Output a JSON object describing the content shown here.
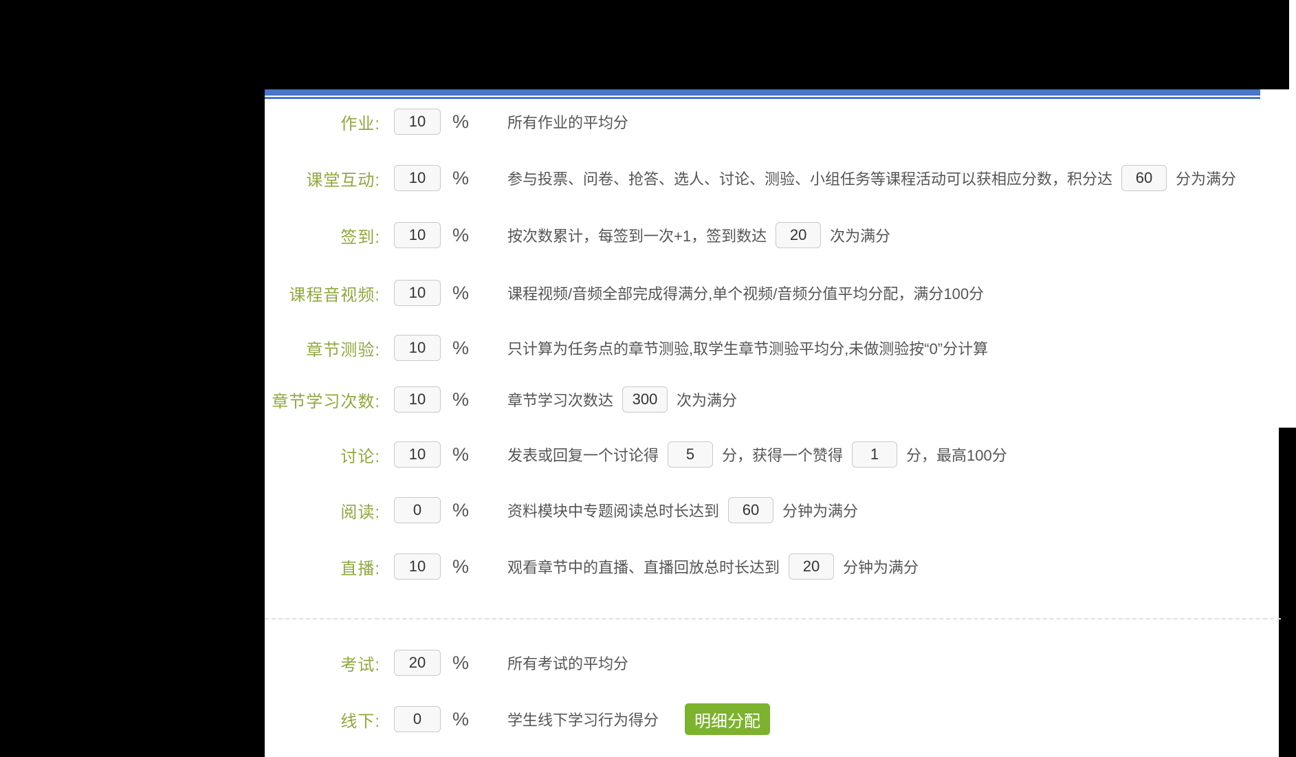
{
  "colors": {
    "accent_blue": "#4a76c8",
    "label_green": "#8fa83e",
    "button_green": "#7cb22e",
    "desc_gray": "#555555"
  },
  "weights_form": {
    "percent_sign": "%",
    "rows": [
      {
        "id": "homework",
        "label": "作业:",
        "percent": "10",
        "desc": [
          {
            "t": "所有作业的平均分"
          }
        ]
      },
      {
        "id": "class-interaction",
        "label": "课堂互动:",
        "percent": "10",
        "desc": [
          {
            "t": "参与投票、问卷、抢答、选人、讨论、测验、小组任务等课程活动可以获相应分数，积分达"
          },
          {
            "v": "60"
          },
          {
            "t": "分为满分"
          }
        ]
      },
      {
        "id": "sign-in",
        "label": "签到:",
        "percent": "10",
        "desc": [
          {
            "t": "按次数累计，每签到一次+1，签到数达"
          },
          {
            "v": "20"
          },
          {
            "t": "次为满分"
          }
        ]
      },
      {
        "id": "course-av",
        "label": "课程音视频:",
        "percent": "10",
        "desc": [
          {
            "t": "课程视频/音频全部完成得满分,单个视频/音频分值平均分配，满分100分"
          }
        ]
      },
      {
        "id": "chapter-quiz",
        "label": "章节测验:",
        "percent": "10",
        "desc": [
          {
            "t": "只计算为任务点的章节测验,取学生章节测验平均分,未做测验按“0”分计算"
          }
        ]
      },
      {
        "id": "chapter-visits",
        "label": "章节学习次数:",
        "percent": "10",
        "desc": [
          {
            "t": "章节学习次数达"
          },
          {
            "v": "300"
          },
          {
            "t": "次为满分"
          }
        ]
      },
      {
        "id": "discussion",
        "label": "讨论:",
        "percent": "10",
        "desc": [
          {
            "t": "发表或回复一个讨论得"
          },
          {
            "v": "5"
          },
          {
            "t": "分，获得一个赞得"
          },
          {
            "v": "1"
          },
          {
            "t": "分，最高100分"
          }
        ]
      },
      {
        "id": "reading",
        "label": "阅读:",
        "percent": "0",
        "desc": [
          {
            "t": "资料模块中专题阅读总时长达到"
          },
          {
            "v": "60"
          },
          {
            "t": "分钟为满分"
          }
        ]
      },
      {
        "id": "live",
        "label": "直播:",
        "percent": "10",
        "desc": [
          {
            "t": "观看章节中的直播、直播回放总时长达到"
          },
          {
            "v": "20"
          },
          {
            "t": "分钟为满分"
          }
        ]
      },
      {
        "id": "exam",
        "label": "考试:",
        "percent": "20",
        "desc": [
          {
            "t": "所有考试的平均分"
          }
        ]
      },
      {
        "id": "offline",
        "label": "线下:",
        "percent": "0",
        "desc": [
          {
            "t": "学生线下学习行为得分"
          }
        ],
        "button": "明细分配"
      }
    ]
  }
}
